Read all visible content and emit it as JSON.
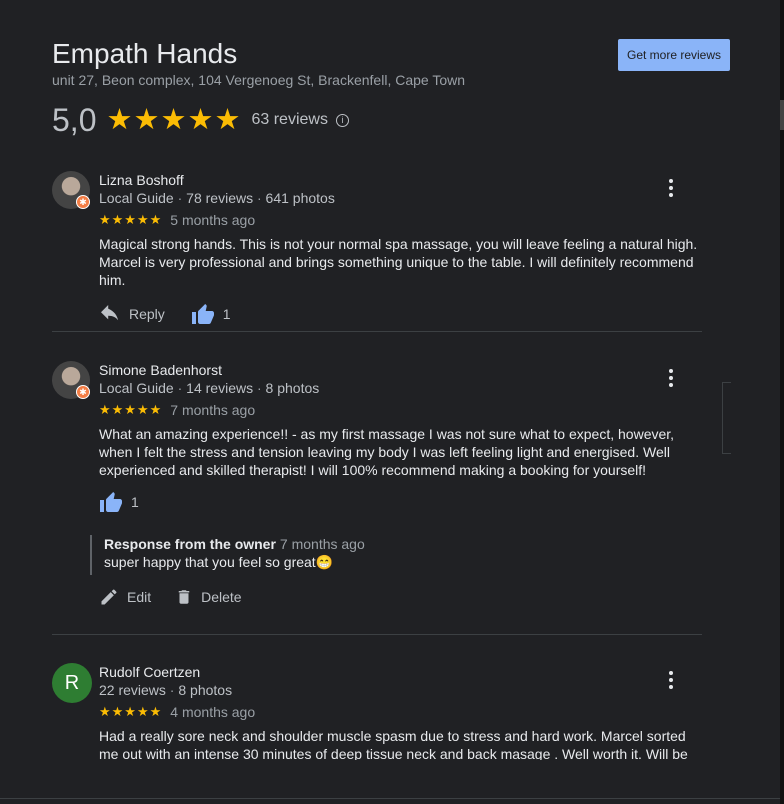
{
  "place": {
    "name": "Empath Hands",
    "address": "unit 27, Beon complex, 104 Vergenoeg St, Brackenfell, Cape Town",
    "more_reviews_label": "Get more reviews",
    "rating": "5,0",
    "stars": "★★★★★",
    "rating_value": 5.0,
    "review_count": "63 reviews"
  },
  "reviews": [
    {
      "name": "Lizna Boshoff",
      "meta_guide": "Local Guide",
      "meta_reviews": "78 reviews",
      "meta_photos": "641 photos",
      "stars": "★★★★★",
      "time": "5 months ago",
      "text": "Magical strong hands. This is not your normal spa massage, you will leave feeling a natural high. Marcel is very professional and brings something unique to the table. I will definitely recommend him.",
      "reply_label": "Reply",
      "likes": "1"
    },
    {
      "name": "Simone Badenhorst",
      "meta_guide": "Local Guide",
      "meta_reviews": "14 reviews",
      "meta_photos": "8 photos",
      "stars": "★★★★★",
      "time": "7 months ago",
      "text": "What an amazing experience!! - as my first massage I was not sure what to expect, however, when I felt the stress and tension leaving my body I was left feeling light and energised. Well experienced and skilled therapist! I will 100% recommend making a booking for yourself!",
      "likes": "1",
      "owner_title": "Response from the owner",
      "owner_time": "7 months ago",
      "owner_text": "super happy that you feel so great😁",
      "edit_label": "Edit",
      "delete_label": "Delete"
    },
    {
      "avatar_letter": "R",
      "name": "Rudolf Coertzen",
      "meta_reviews": "22 reviews",
      "meta_photos": "8 photos",
      "stars": "★★★★★",
      "time": "4 months ago",
      "text": "Had a really sore neck and shoulder muscle spasm due to stress and hard work. Marcel sorted me out with an intense 30 minutes of deep tissue neck and back masage . Well worth it. Will be back for follow-"
    }
  ],
  "colors": {
    "background": "#202124",
    "accent": "#8ab4f8",
    "star": "#fbbc04",
    "guide_badge": "#f37e46",
    "avatar_green": "#2e7d32"
  }
}
